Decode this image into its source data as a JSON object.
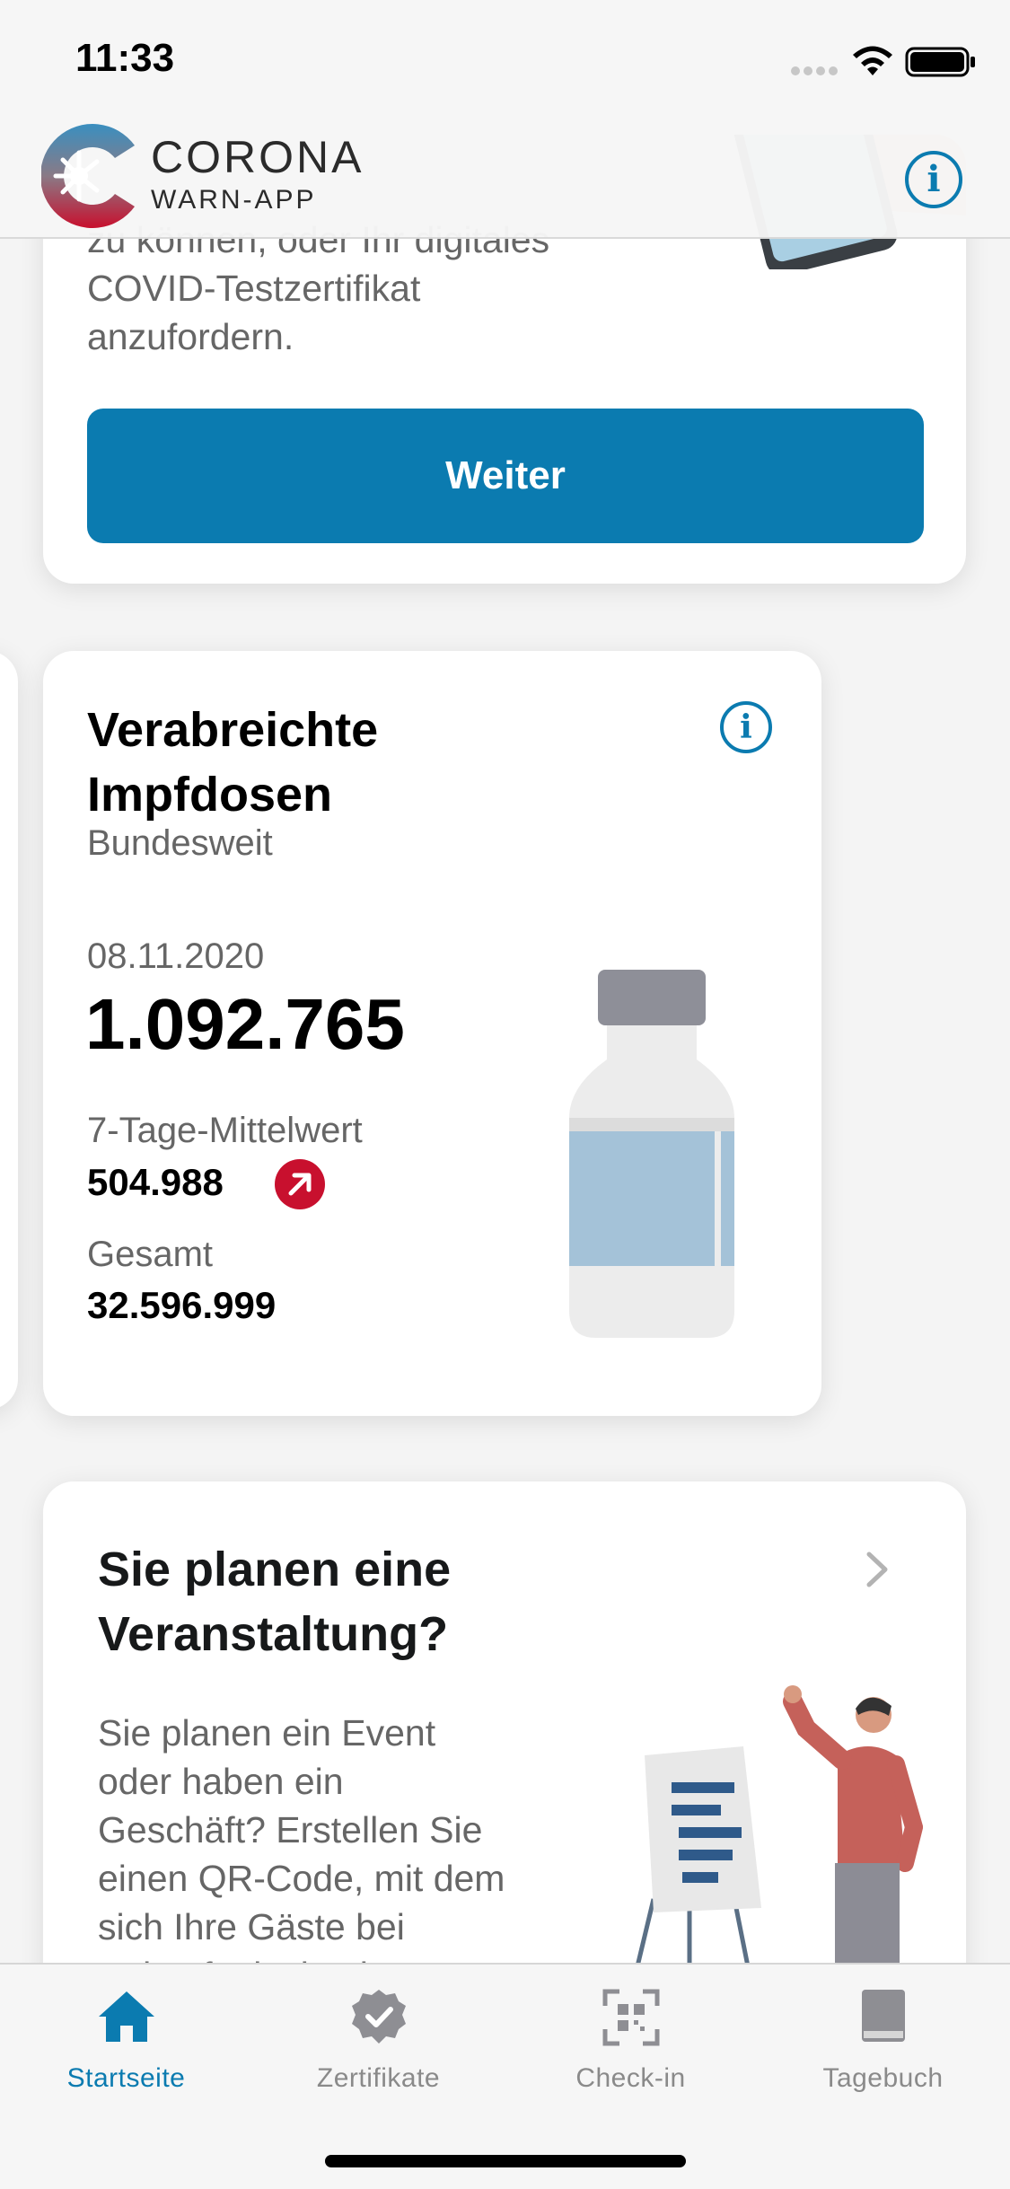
{
  "status_bar": {
    "time": "11:33"
  },
  "header": {
    "app_title": "CORONA",
    "app_subtitle": "WARN-APP"
  },
  "test_card": {
    "text_lines": [
      "zu können, oder Ihr digitales",
      "COVID-Testzertifikat",
      "anzufordern."
    ],
    "button_label": "Weiter"
  },
  "vaccination_card": {
    "title_line1": "Verabreichte",
    "title_line2": "Impfdosen",
    "region": "Bundesweit",
    "date": "08.11.2020",
    "value": "1.092.765",
    "avg_label": "7-Tage-Mittelwert",
    "avg_value": "504.988",
    "total_label": "Gesamt",
    "total_value": "32.596.999",
    "trend": "up",
    "colors": {
      "trend": "#c8102e"
    }
  },
  "event_card": {
    "title_line1": "Sie planen eine",
    "title_line2": "Veranstaltung?",
    "text_lines": [
      "Sie planen ein Event",
      "oder haben ein",
      "Geschäft? Erstellen Sie",
      "einen QR-Code, mit dem",
      "sich Ihre Gäste bei",
      "Ankunft einchecken"
    ]
  },
  "tabbar": {
    "tabs": [
      {
        "label": "Startseite",
        "icon": "home-icon",
        "active": true
      },
      {
        "label": "Zertifikate",
        "icon": "certificate-icon",
        "active": false
      },
      {
        "label": "Check-in",
        "icon": "qr-scan-icon",
        "active": false
      },
      {
        "label": "Tagebuch",
        "icon": "book-icon",
        "active": false
      }
    ]
  },
  "colors": {
    "accent": "#0b7bb0",
    "background": "#f4f4f4"
  }
}
